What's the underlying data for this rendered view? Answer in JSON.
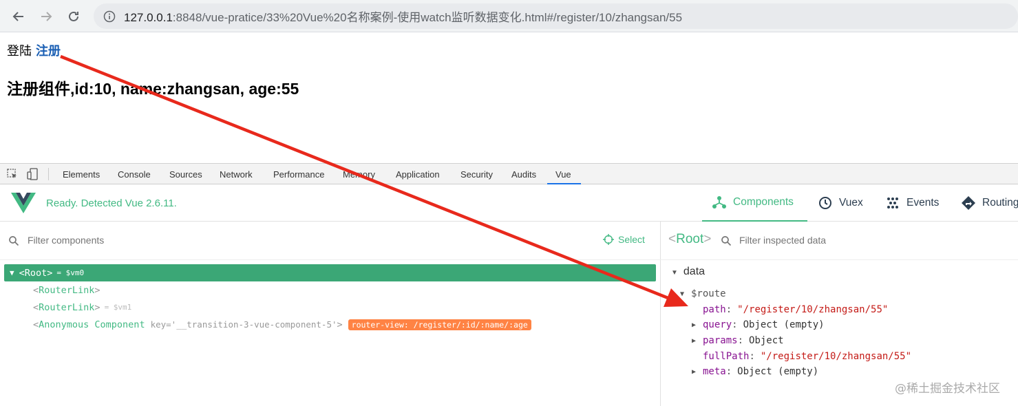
{
  "browser": {
    "url_host": "127.0.0.1",
    "url_path": ":8848/vue-pratice/33%20Vue%20名称案例-使用watch监听数据变化.html#/register/10/zhangsan/55"
  },
  "page": {
    "link_login": "登陆",
    "link_register": "注册",
    "heading": "注册组件,id:10, name:zhangsan, age:55"
  },
  "devtools": {
    "tabs": [
      "Elements",
      "Console",
      "Sources",
      "Network",
      "Performance",
      "Memory",
      "Application",
      "Security",
      "Audits",
      "Vue"
    ],
    "active_tab": "Vue"
  },
  "vue": {
    "status": "Ready. Detected Vue 2.6.11.",
    "nav": {
      "components": "Components",
      "vuex": "Vuex",
      "events": "Events",
      "routing": "Routing"
    },
    "filter_placeholder": "Filter components",
    "select_label": "Select",
    "tree": {
      "root": "Root",
      "root_ref": "= $vm0",
      "router_link_1": "RouterLink",
      "router_link_2": "RouterLink",
      "router_link_2_ref": "= $vm1",
      "anonymous": "Anonymous Component",
      "anonymous_key": "key='__transition-3-vue-component-5'",
      "route_badge": "router-view: /register/:id/:name/:age"
    },
    "inspector": {
      "root_label": "Root",
      "filter_placeholder": "Filter inspected data",
      "data_label": "data",
      "route_key": "$route",
      "path_key": "path",
      "path_value": "\"/register/10/zhangsan/55\"",
      "query_key": "query",
      "query_value": "Object (empty)",
      "params_key": "params",
      "params_value": "Object",
      "fullpath_key": "fullPath",
      "fullpath_value": "\"/register/10/zhangsan/55\"",
      "meta_key": "meta",
      "meta_value": "Object (empty)"
    }
  },
  "watermark": "@稀土掘金技术社区",
  "colors": {
    "vue_green": "#42b983",
    "selected_row": "#3ba776",
    "badge_orange": "#ff8344",
    "arrow_red": "#e8291c",
    "link_blue": "#1a5fb4"
  }
}
